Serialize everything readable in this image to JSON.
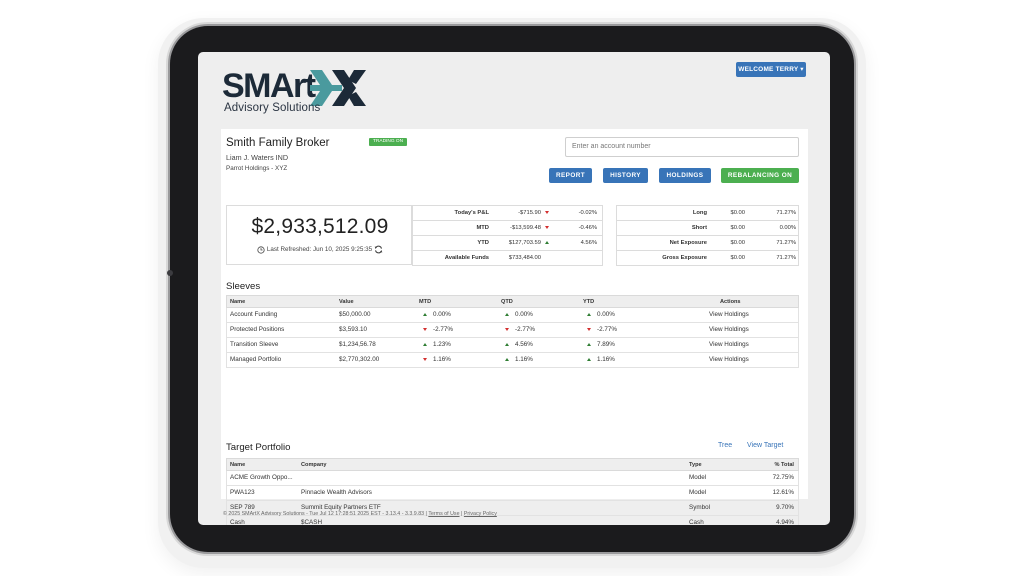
{
  "logo": {
    "wordmark": "SMArt",
    "subtitle": "Advisory Solutions"
  },
  "header": {
    "welcome": "WELCOME TERRY ▾"
  },
  "account": {
    "name": "Smith Family Broker",
    "status_badge": "TRADING ON",
    "owner": "Liam J. Waters IND",
    "firm": "Parrot Holdings - XYZ",
    "search_placeholder": "Enter an account number"
  },
  "actions": {
    "report": "REPORT",
    "history": "HISTORY",
    "holdings": "HOLDINGS",
    "rebalancing": "REBALANCING ON"
  },
  "balance": {
    "value": "$2,933,512.09",
    "refreshed": "Last Refreshed: Jun 10, 2025 9:25:35"
  },
  "pnl_stats": [
    {
      "label": "Today's P&L",
      "value": "-$715.90",
      "dir": "down",
      "pct": "-0.02%"
    },
    {
      "label": "MTD",
      "value": "-$13,599.48",
      "dir": "down",
      "pct": "-0.46%"
    },
    {
      "label": "YTD",
      "value": "$127,703.59",
      "dir": "up",
      "pct": "4.56%"
    },
    {
      "label": "Available Funds",
      "value": "$733,484.00",
      "dir": "",
      "pct": ""
    }
  ],
  "exposure_stats": [
    {
      "label": "Long",
      "value": "$0.00",
      "pct": "71.27%"
    },
    {
      "label": "Short",
      "value": "$0.00",
      "pct": "0.00%"
    },
    {
      "label": "Net Exposure",
      "value": "$0.00",
      "pct": "71.27%"
    },
    {
      "label": "Gross Exposure",
      "value": "$0.00",
      "pct": "71.27%"
    }
  ],
  "sleeves": {
    "title": "Sleeves",
    "headers": {
      "name": "Name",
      "value": "Value",
      "mtd": "MTD",
      "qtd": "QTD",
      "ytd": "YTD",
      "actions": "Actions"
    },
    "rows": [
      {
        "name": "Account Funding",
        "value": "$50,000.00",
        "mtd": "0.00%",
        "mtd_dir": "up",
        "qtd": "0.00%",
        "qtd_dir": "up",
        "ytd": "0.00%",
        "ytd_dir": "up",
        "action": "View Holdings"
      },
      {
        "name": "Protected Positions",
        "value": "$3,593.10",
        "mtd": "-2.77%",
        "mtd_dir": "down",
        "qtd": "-2.77%",
        "qtd_dir": "down",
        "ytd": "-2.77%",
        "ytd_dir": "down",
        "action": "View Holdings"
      },
      {
        "name": "Transition Sleeve",
        "value": "$1,234,56.78",
        "mtd": "1.23%",
        "mtd_dir": "up",
        "qtd": "4.56%",
        "qtd_dir": "up",
        "ytd": "7.89%",
        "ytd_dir": "up",
        "action": "View Holdings"
      },
      {
        "name": "Managed Portfolio",
        "value": "$2,770,302.00",
        "mtd": "1.16%",
        "mtd_dir": "down",
        "qtd": "1.16%",
        "qtd_dir": "up",
        "ytd": "1.16%",
        "ytd_dir": "up",
        "action": "View Holdings"
      }
    ]
  },
  "target": {
    "title": "Target Portfolio",
    "tree_link": "Tree",
    "view_link": "View Target",
    "headers": {
      "name": "Name",
      "company": "Company",
      "type": "Type",
      "pct": "% Total"
    },
    "rows": [
      {
        "name": "ACME Growth Oppo...",
        "company": "",
        "type": "Model",
        "pct": "72.75%"
      },
      {
        "name": "PWA123",
        "company": "Pinnacle Wealth Advisors",
        "type": "Model",
        "pct": "12.61%"
      },
      {
        "name": "SEP 789",
        "company": "Summit Equity Partners ETF",
        "type": "Symbol",
        "pct": "9.70%"
      },
      {
        "name": "Cash",
        "company": "$CASH",
        "type": "Cash",
        "pct": "4.94%"
      }
    ]
  },
  "footer": {
    "text": "© 2025 SMArtX Advisory Solutions - Tue Jul 12 17:28:51 2025 EST - 3.13.4 - 3.3.9.83 |",
    "terms": "Terms of Use",
    "sep": "|",
    "privacy": "Privacy Policy"
  },
  "colors": {
    "primary": "#3874b8",
    "success": "#4caf50",
    "brand_dark": "#1c2a38",
    "brand_teal": "#4a9a9e",
    "up": "#2e7d32",
    "down": "#d32f2f"
  }
}
